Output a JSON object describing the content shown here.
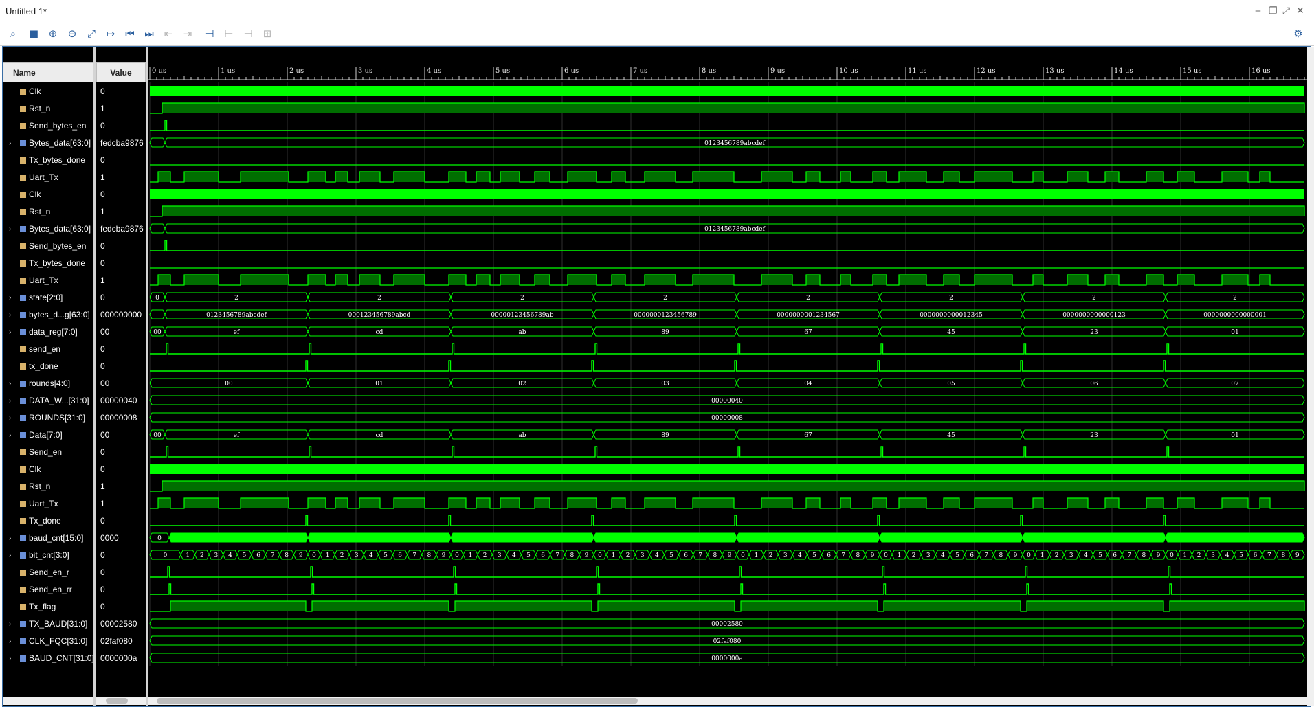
{
  "window": {
    "title": "Untitled 1*"
  },
  "toolbar": {
    "buttons": [
      {
        "name": "search-icon",
        "glyph": "⌕",
        "enabled": true
      },
      {
        "name": "save-icon",
        "glyph": "■",
        "enabled": true
      },
      {
        "name": "zoom-in-icon",
        "glyph": "⊕",
        "enabled": true
      },
      {
        "name": "zoom-out-icon",
        "glyph": "⊖",
        "enabled": true
      },
      {
        "name": "zoom-fit-icon",
        "glyph": "⤢",
        "enabled": true
      },
      {
        "name": "go-to-cursor-icon",
        "glyph": "↦",
        "enabled": true
      },
      {
        "name": "go-to-time-zero-icon",
        "glyph": "⏮",
        "enabled": true
      },
      {
        "name": "go-to-last-time-icon",
        "glyph": "⏭",
        "enabled": true
      },
      {
        "name": "previous-transition-icon",
        "glyph": "⇤",
        "enabled": false
      },
      {
        "name": "next-transition-icon",
        "glyph": "⇥",
        "enabled": false
      },
      {
        "name": "add-marker-icon",
        "glyph": "⊣",
        "enabled": true
      },
      {
        "name": "previous-marker-icon",
        "glyph": "⊢",
        "enabled": false
      },
      {
        "name": "next-marker-icon",
        "glyph": "⊣",
        "enabled": false
      },
      {
        "name": "swap-cursors-icon",
        "glyph": "⊞",
        "enabled": false
      }
    ],
    "settings_icon": "gear-icon"
  },
  "columns": {
    "name": "Name",
    "value": "Value"
  },
  "timeline": {
    "ticks": [
      "0 us",
      "1 us",
      "2 us",
      "3 us",
      "4 us",
      "5 us",
      "6 us",
      "7 us",
      "8 us",
      "9 us",
      "10 us",
      "11 us",
      "12 us",
      "13 us",
      "14 us",
      "15 us",
      "16 us"
    ]
  },
  "colors": {
    "wave": "#00ff00",
    "wave_fill": "#006e00",
    "grid": "#2f2f2f",
    "background": "#000000"
  },
  "signals": [
    {
      "name": "Clk",
      "value": "0",
      "kind": "bit",
      "expandable": false,
      "wave": "clk"
    },
    {
      "name": "Rst_n",
      "value": "1",
      "kind": "bit",
      "expandable": false,
      "wave": "rst"
    },
    {
      "name": "Send_bytes_en",
      "value": "0",
      "kind": "bit",
      "expandable": false,
      "wave": "pulse",
      "pulses": [
        0.22
      ]
    },
    {
      "name": "Bytes_data[63:0]",
      "value": "fedcba9876",
      "kind": "bus",
      "expandable": true,
      "wave": "bus",
      "segments": [
        {
          "end": 0.22,
          "label": ""
        },
        {
          "end": 16.8,
          "label": "0123456789abcdef"
        }
      ]
    },
    {
      "name": "Tx_bytes_done",
      "value": "0",
      "kind": "bit",
      "expandable": false,
      "wave": "low"
    },
    {
      "name": "Uart_Tx",
      "value": "1",
      "kind": "bit",
      "expandable": false,
      "wave": "uart"
    },
    {
      "name": "Clk",
      "value": "0",
      "kind": "bit",
      "expandable": false,
      "wave": "clk"
    },
    {
      "name": "Rst_n",
      "value": "1",
      "kind": "bit",
      "expandable": false,
      "wave": "rst"
    },
    {
      "name": "Bytes_data[63:0]",
      "value": "fedcba9876",
      "kind": "bus",
      "expandable": true,
      "wave": "bus",
      "segments": [
        {
          "end": 0.22,
          "label": ""
        },
        {
          "end": 16.8,
          "label": "0123456789abcdef"
        }
      ]
    },
    {
      "name": "Send_bytes_en",
      "value": "0",
      "kind": "bit",
      "expandable": false,
      "wave": "pulse",
      "pulses": [
        0.22
      ]
    },
    {
      "name": "Tx_bytes_done",
      "value": "0",
      "kind": "bit",
      "expandable": false,
      "wave": "low"
    },
    {
      "name": "Uart_Tx",
      "value": "1",
      "kind": "bit",
      "expandable": false,
      "wave": "uart"
    },
    {
      "name": "state[2:0]",
      "value": "0",
      "kind": "bus",
      "expandable": true,
      "wave": "bus",
      "segments": [
        {
          "end": 0.22,
          "label": "0"
        },
        {
          "end": 2.3,
          "label": "2"
        },
        {
          "end": 4.38,
          "label": "2"
        },
        {
          "end": 6.46,
          "label": "2"
        },
        {
          "end": 8.54,
          "label": "2"
        },
        {
          "end": 10.62,
          "label": "2"
        },
        {
          "end": 12.7,
          "label": "2"
        },
        {
          "end": 14.78,
          "label": "2"
        },
        {
          "end": 16.8,
          "label": "2"
        }
      ]
    },
    {
      "name": "bytes_d...g[63:0]",
      "value": "000000000",
      "kind": "bus",
      "expandable": true,
      "wave": "bus",
      "segments": [
        {
          "end": 0.22,
          "label": ""
        },
        {
          "end": 2.3,
          "label": "0123456789abcdef"
        },
        {
          "end": 4.38,
          "label": "000123456789abcd"
        },
        {
          "end": 6.46,
          "label": "00000123456789ab"
        },
        {
          "end": 8.54,
          "label": "0000000123456789"
        },
        {
          "end": 10.62,
          "label": "0000000001234567"
        },
        {
          "end": 12.7,
          "label": "0000000000012345"
        },
        {
          "end": 14.78,
          "label": "0000000000000123"
        },
        {
          "end": 16.8,
          "label": "0000000000000001"
        }
      ]
    },
    {
      "name": "data_reg[7:0]",
      "value": "00",
      "kind": "bus",
      "expandable": true,
      "wave": "bus",
      "segments": [
        {
          "end": 0.22,
          "label": "00"
        },
        {
          "end": 2.3,
          "label": "ef"
        },
        {
          "end": 4.38,
          "label": "cd"
        },
        {
          "end": 6.46,
          "label": "ab"
        },
        {
          "end": 8.54,
          "label": "89"
        },
        {
          "end": 10.62,
          "label": "67"
        },
        {
          "end": 12.7,
          "label": "45"
        },
        {
          "end": 14.78,
          "label": "23"
        },
        {
          "end": 16.8,
          "label": "01"
        }
      ]
    },
    {
      "name": "send_en",
      "value": "0",
      "kind": "bit",
      "expandable": false,
      "wave": "pulse",
      "pulses": [
        0.24,
        2.32,
        4.4,
        6.48,
        8.56,
        10.64,
        12.72,
        14.8
      ]
    },
    {
      "name": "tx_done",
      "value": "0",
      "kind": "bit",
      "expandable": false,
      "wave": "pulse",
      "pulses": [
        2.27,
        4.35,
        6.43,
        8.51,
        10.59,
        12.67,
        14.75
      ]
    },
    {
      "name": "rounds[4:0]",
      "value": "00",
      "kind": "bus",
      "expandable": true,
      "wave": "bus",
      "segments": [
        {
          "end": 2.3,
          "label": "00"
        },
        {
          "end": 4.38,
          "label": "01"
        },
        {
          "end": 6.46,
          "label": "02"
        },
        {
          "end": 8.54,
          "label": "03"
        },
        {
          "end": 10.62,
          "label": "04"
        },
        {
          "end": 12.7,
          "label": "05"
        },
        {
          "end": 14.78,
          "label": "06"
        },
        {
          "end": 16.8,
          "label": "07"
        }
      ]
    },
    {
      "name": "DATA_W...[31:0]",
      "value": "00000040",
      "kind": "bus",
      "expandable": true,
      "wave": "bus",
      "segments": [
        {
          "end": 16.8,
          "label": "00000040"
        }
      ]
    },
    {
      "name": "ROUNDS[31:0]",
      "value": "00000008",
      "kind": "bus",
      "expandable": true,
      "wave": "bus",
      "segments": [
        {
          "end": 16.8,
          "label": "00000008"
        }
      ]
    },
    {
      "name": "Data[7:0]",
      "value": "00",
      "kind": "bus",
      "expandable": true,
      "wave": "bus",
      "segments": [
        {
          "end": 0.22,
          "label": "00"
        },
        {
          "end": 2.3,
          "label": "ef"
        },
        {
          "end": 4.38,
          "label": "cd"
        },
        {
          "end": 6.46,
          "label": "ab"
        },
        {
          "end": 8.54,
          "label": "89"
        },
        {
          "end": 10.62,
          "label": "67"
        },
        {
          "end": 12.7,
          "label": "45"
        },
        {
          "end": 14.78,
          "label": "23"
        },
        {
          "end": 16.8,
          "label": "01"
        }
      ]
    },
    {
      "name": "Send_en",
      "value": "0",
      "kind": "bit",
      "expandable": false,
      "wave": "pulse",
      "pulses": [
        0.24,
        2.32,
        4.4,
        6.48,
        8.56,
        10.64,
        12.72,
        14.8
      ]
    },
    {
      "name": "Clk",
      "value": "0",
      "kind": "bit",
      "expandable": false,
      "wave": "clk"
    },
    {
      "name": "Rst_n",
      "value": "1",
      "kind": "bit",
      "expandable": false,
      "wave": "rst"
    },
    {
      "name": "Uart_Tx",
      "value": "1",
      "kind": "bit",
      "expandable": false,
      "wave": "uart"
    },
    {
      "name": "Tx_done",
      "value": "0",
      "kind": "bit",
      "expandable": false,
      "wave": "pulse",
      "pulses": [
        2.27,
        4.35,
        6.43,
        8.51,
        10.59,
        12.67,
        14.75
      ]
    },
    {
      "name": "baud_cnt[15:0]",
      "value": "0000",
      "kind": "bus",
      "expandable": true,
      "wave": "busfill",
      "segments": [
        {
          "end": 0.28,
          "label": "0"
        },
        {
          "end": 2.3,
          "label": ""
        },
        {
          "end": 4.38,
          "label": ""
        },
        {
          "end": 6.46,
          "label": ""
        },
        {
          "end": 8.54,
          "label": ""
        },
        {
          "end": 10.62,
          "label": ""
        },
        {
          "end": 12.7,
          "label": ""
        },
        {
          "end": 14.78,
          "label": ""
        },
        {
          "end": 16.8,
          "label": ""
        }
      ]
    },
    {
      "name": "bit_cnt[3:0]",
      "value": "0",
      "kind": "bus",
      "expandable": true,
      "wave": "bitcnt"
    },
    {
      "name": "Send_en_r",
      "value": "0",
      "kind": "bit",
      "expandable": false,
      "wave": "pulse",
      "pulses": [
        0.26,
        2.34,
        4.42,
        6.5,
        8.58,
        10.66,
        12.74,
        14.82
      ]
    },
    {
      "name": "Send_en_rr",
      "value": "0",
      "kind": "bit",
      "expandable": false,
      "wave": "pulse",
      "pulses": [
        0.28,
        2.36,
        4.44,
        6.52,
        8.6,
        10.68,
        12.76,
        14.84
      ]
    },
    {
      "name": "Tx_flag",
      "value": "0",
      "kind": "bit",
      "expandable": false,
      "wave": "txflag"
    },
    {
      "name": "TX_BAUD[31:0]",
      "value": "00002580",
      "kind": "bus",
      "expandable": true,
      "wave": "bus",
      "segments": [
        {
          "end": 16.8,
          "label": "00002580"
        }
      ]
    },
    {
      "name": "CLK_FQC[31:0]",
      "value": "02faf080",
      "kind": "bus",
      "expandable": true,
      "wave": "bus",
      "segments": [
        {
          "end": 16.8,
          "label": "02faf080"
        }
      ]
    },
    {
      "name": "BAUD_CNT[31:0]",
      "value": "0000000a",
      "kind": "bus",
      "expandable": true,
      "wave": "bus",
      "segments": [
        {
          "end": 16.8,
          "label": "0000000a"
        }
      ]
    }
  ],
  "bit_cnt_labels": [
    "0",
    "1",
    "2",
    "3",
    "4",
    "5",
    "6",
    "7",
    "8",
    "9"
  ],
  "uart_high_intervals": [
    [
      0.12,
      0.3
    ],
    [
      0.5,
      1.0
    ],
    [
      1.32,
      2.02
    ],
    [
      2.3,
      2.56
    ],
    [
      2.7,
      2.88
    ],
    [
      3.05,
      3.35
    ],
    [
      3.55,
      4.0
    ],
    [
      4.35,
      4.6
    ],
    [
      4.75,
      4.95
    ],
    [
      5.1,
      5.38
    ],
    [
      5.6,
      5.82
    ],
    [
      6.08,
      6.5
    ],
    [
      6.72,
      6.92
    ],
    [
      7.2,
      7.65
    ],
    [
      7.9,
      8.5
    ],
    [
      8.9,
      9.35
    ],
    [
      9.55,
      9.75
    ],
    [
      10.05,
      10.2
    ],
    [
      10.52,
      10.72
    ],
    [
      10.9,
      11.3
    ],
    [
      11.55,
      11.78
    ],
    [
      12.0,
      12.55
    ],
    [
      12.85,
      13.0
    ],
    [
      13.35,
      13.65
    ],
    [
      13.9,
      14.1
    ],
    [
      14.5,
      14.75
    ],
    [
      14.95,
      15.2
    ],
    [
      15.6,
      15.98
    ],
    [
      16.15,
      16.3
    ]
  ]
}
